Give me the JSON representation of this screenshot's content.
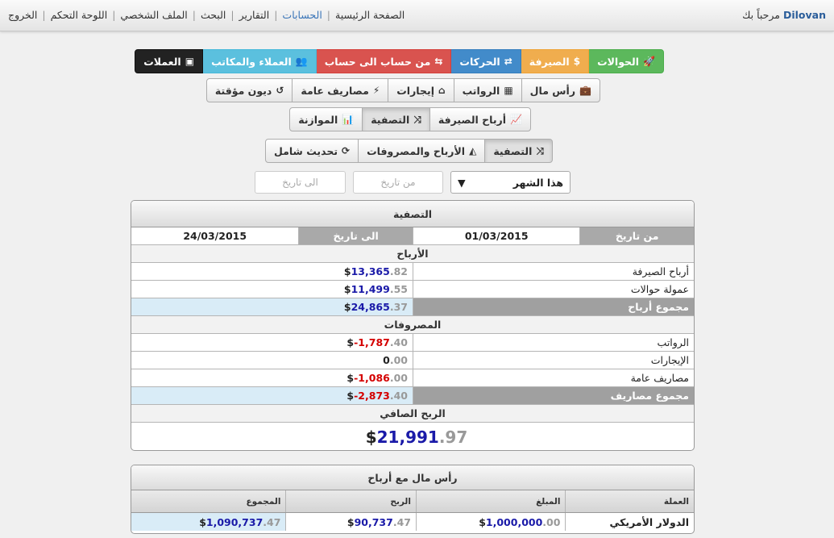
{
  "header": {
    "welcome_prefix": "مرحباً بك",
    "username": "Dilovan",
    "nav": [
      {
        "label": "الصفحة الرئيسية",
        "active": false
      },
      {
        "label": "الحسابات",
        "active": true
      },
      {
        "label": "التقارير",
        "active": false
      },
      {
        "label": "البحث",
        "active": false
      },
      {
        "label": "الملف الشخصي",
        "active": false
      },
      {
        "label": "اللوحة التحكم",
        "active": false
      },
      {
        "label": "الخروج",
        "active": false
      }
    ],
    "separator": "|"
  },
  "toolbar1": [
    "الحوالات",
    "الصيرفة",
    "الحركات",
    "من حساب الى حساب",
    "العملاء والمكاتب",
    "العملات"
  ],
  "toolbar2": [
    "رأس مال",
    "الرواتب",
    "إيجارات",
    "مصاريف عامة",
    "ديون مؤقتة"
  ],
  "toolbar3": [
    "أرباح الصيرفة",
    "التصفية",
    "الموازنة"
  ],
  "toolbar4": [
    "التصفية",
    "الأرباح والمصروفات",
    "تحديث شامل"
  ],
  "filters": {
    "period": "هذا الشهر",
    "from_placeholder": "من تاريخ",
    "to_placeholder": "الى تاريخ"
  },
  "settlement": {
    "title": "التصفية",
    "from_label": "من تاريخ",
    "from_value": "01/03/2015",
    "to_label": "الى تاريخ",
    "to_value": "24/03/2015",
    "currency": "$",
    "profits_heading": "الأرباح",
    "profits": [
      {
        "label": "أرباح الصيرفة",
        "int": "13,365",
        "dec": ".82"
      },
      {
        "label": "عمولة حوالات",
        "int": "11,499",
        "dec": ".55"
      }
    ],
    "profits_total": {
      "label": "مجموع أرباح",
      "int": "24,865",
      "dec": ".37"
    },
    "expenses_heading": "المصروفات",
    "expenses": [
      {
        "label": "الرواتب",
        "int": "-1,787",
        "dec": ".40",
        "tone": "red"
      },
      {
        "label": "الإيجارات",
        "int": "0",
        "dec": ".00",
        "tone": "black"
      },
      {
        "label": "مصاريف عامة",
        "int": "-1,086",
        "dec": ".00",
        "tone": "red"
      }
    ],
    "expenses_total": {
      "label": "مجموع مصاريف",
      "int": "-2,873",
      "dec": ".40"
    },
    "net_label": "الربح الصافي",
    "net_int": "21,991",
    "net_dec": ".97"
  },
  "capital": {
    "title": "رأس مال مع أرباح",
    "columns": [
      "العملة",
      "المبلغ",
      "الربح",
      "المجموع"
    ],
    "currency": "$",
    "row": {
      "currency_name": "الدولار الأمريكي",
      "amount_int": "1,000,000",
      "amount_dec": ".00",
      "profit_int": "90,737",
      "profit_dec": ".47",
      "total_int": "1,090,737",
      "total_dec": ".47"
    }
  },
  "colors": {
    "green": "#5cb85c",
    "orange": "#f0ad4e",
    "blue": "#428bca",
    "red": "#d9534f",
    "light_blue": "#5bc0de",
    "black": "#222222",
    "value_blue": "#1a1aa8",
    "value_red": "#d40000"
  },
  "icons": {
    "toolbar1": [
      "rocket-icon",
      "dollar-icon",
      "exchange-icon",
      "retweet-icon",
      "users-icon",
      "money-icon"
    ],
    "toolbar2": [
      "briefcase-icon",
      "calendar-icon",
      "home-icon",
      "bolt-icon",
      "history-icon"
    ],
    "toolbar3": [
      "line-chart-icon",
      "random-icon",
      "bar-chart-icon"
    ],
    "toolbar4": [
      "random-icon",
      "area-chart-icon",
      "refresh-icon"
    ]
  }
}
